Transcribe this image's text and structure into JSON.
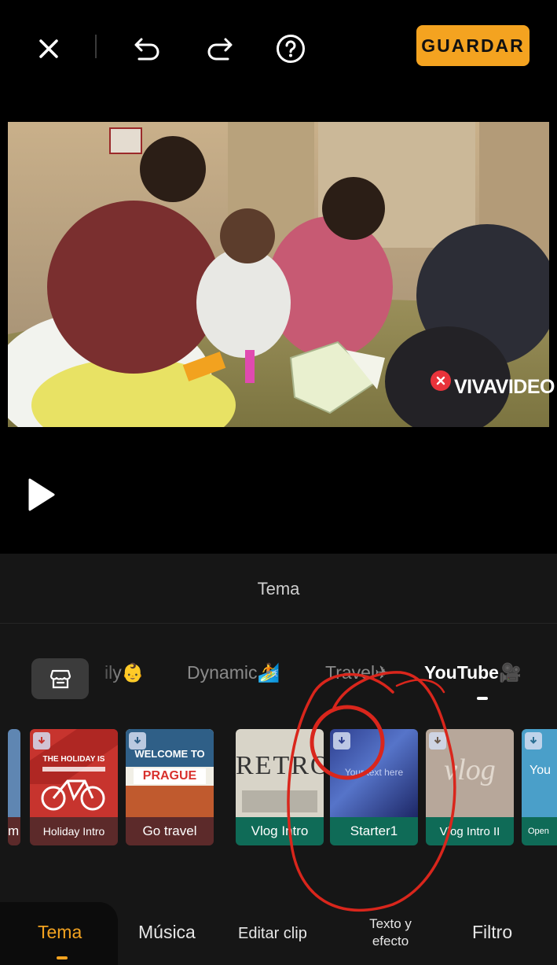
{
  "topbar": {
    "close_icon": "close-icon",
    "undo_icon": "undo-icon",
    "redo_icon": "redo-icon",
    "help_icon": "help-icon",
    "save_label": "GUARDAR"
  },
  "preview": {
    "watermark": "VIVAVIDEO",
    "play_icon": "play-icon"
  },
  "panel": {
    "title": "Tema",
    "store_icon": "store-icon",
    "categories": [
      {
        "label": "ily",
        "emoji": "👶"
      },
      {
        "label": "Dynamic",
        "emoji": "🏄"
      },
      {
        "label": "Travel",
        "emoji": "✈"
      },
      {
        "label": "YouTube",
        "emoji": "🎥",
        "active": true
      }
    ],
    "themes": [
      {
        "label": "m",
        "thumb_text": ""
      },
      {
        "label": "Holiday Intro",
        "thumb_text": "THE HOLIDAY IS"
      },
      {
        "label": "Go travel",
        "thumb_text_1": "WELCOME TO",
        "thumb_text_2": "PRAGUE"
      },
      {
        "label": "Vlog Intro",
        "thumb_text": "RETRO"
      },
      {
        "label": "Starter1",
        "thumb_text": "Your text here"
      },
      {
        "label": "Vlog Intro II",
        "thumb_text": "vlog"
      },
      {
        "label": "Open",
        "thumb_text": "You"
      }
    ]
  },
  "tabs": [
    {
      "label": "Tema",
      "active": true
    },
    {
      "label": "Música"
    },
    {
      "label": "Editar clip"
    },
    {
      "label_line1": "Texto y",
      "label_line2": "efecto"
    },
    {
      "label": "Filtro"
    }
  ],
  "colors": {
    "accent": "#f4a320",
    "panel_bg": "#161616",
    "card_green": "#0f6b57",
    "card_red": "#5c2a2a",
    "annotation_red": "#d9261c"
  }
}
